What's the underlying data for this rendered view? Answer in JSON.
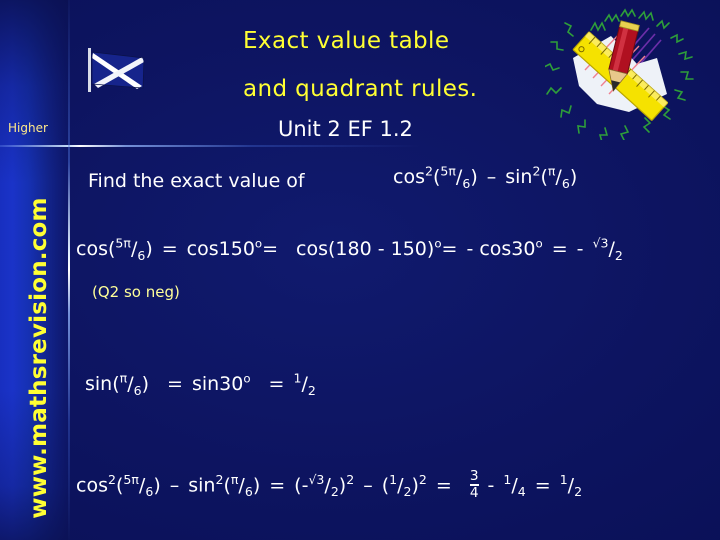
{
  "slide": {
    "title_line1": "Exact value table",
    "title_line2": "and quadrant rules.",
    "unit": "Unit 2 EF 1.2",
    "level_badge": "Higher",
    "website": "www.mathsrevision.com"
  },
  "colors": {
    "background_dark": "#0a1057",
    "background_mid": "#101a6e",
    "left_band_blue": "#1a33c8",
    "title_yellow": "#ffff33",
    "body_white": "#ffffff",
    "note_yellow": "#ffff99",
    "ruler_yellow": "#f5e200",
    "pencil_red": "#b01020",
    "scribble_green": "#2e9e3a"
  },
  "content": {
    "prompt": "Find the exact value of",
    "problem_expression": {
      "cos_base": "cos",
      "cos_power": "2",
      "cos_arg_num": "5π",
      "cos_arg_den": "6",
      "minus": "–",
      "sin_base": "sin",
      "sin_power": "2",
      "sin_arg_num": "π",
      "sin_arg_den": "6"
    },
    "step1": {
      "lhs": "cos",
      "lhs_arg_num": "5π",
      "lhs_arg_den": "6",
      "eq1": "=",
      "term2": "cos150",
      "deg": "o",
      "eq2": "=",
      "term3_open": "cos(180 - 150)",
      "deg2": "o",
      "eq3": "=",
      "term4": "- cos30",
      "deg3": "o",
      "eq4": "=",
      "result_sign": "-",
      "result_num": "√3",
      "result_slash": "/",
      "result_den": "2"
    },
    "note": "(Q2 so neg)",
    "step2": {
      "lhs": "sin",
      "lhs_arg_num": "π",
      "lhs_arg_den": "6",
      "eq1": "=",
      "term2": "sin30",
      "deg": "o",
      "eq2": "=",
      "result_num": "1",
      "result_slash": "/",
      "result_den": "2"
    },
    "step3": {
      "cos_base": "cos",
      "cos_power": "2",
      "cos_arg_num": "5π",
      "cos_arg_den": "6",
      "minus": "–",
      "sin_base": "sin",
      "sin_power": "2",
      "sin_arg_num": "π",
      "sin_arg_den": "6",
      "eq1": "=",
      "t1_open": "(-",
      "t1_num": "√3",
      "t1_slash": "/",
      "t1_den": "2",
      "t1_close": ")",
      "t1_power": "2",
      "minus2": "–",
      "t2_open": "(",
      "t2_num": "1",
      "t2_slash": "/",
      "t2_den": "2",
      "t2_close": ")",
      "t2_power": "2",
      "eq2": "=",
      "f1_num": "3",
      "f1_den": "4",
      "minus3": "-",
      "f2_num": "1",
      "f2_slash": "/",
      "f2_den": "4",
      "eq3": "=",
      "f3_num": "1",
      "f3_slash": "/",
      "f3_den": "2"
    }
  },
  "graphics": {
    "flag": "scottish-saltire-flag-icon",
    "clipart": "ruler-pencil-paper-clipart"
  }
}
